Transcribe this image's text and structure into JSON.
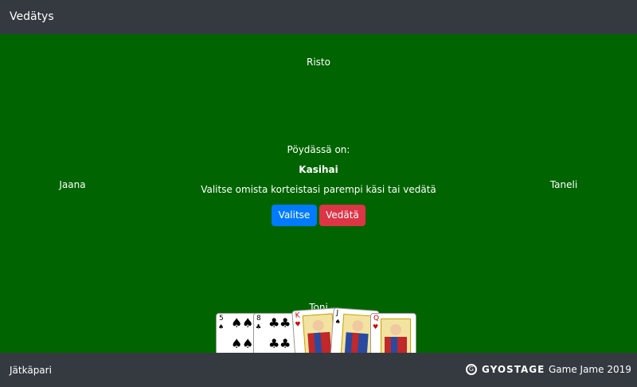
{
  "header": {
    "title": "Vedätys"
  },
  "table": {
    "players": {
      "top": "Risto",
      "left": "Jaana",
      "right": "Taneli",
      "bottom": "Toni"
    },
    "on_table_label": "Pöydässä on:",
    "current_hand": "Kasihai",
    "instruction": "Valitse omista korteistasi parempi käsi tai vedätä",
    "buttons": {
      "choose": "Valitse",
      "bluff": "Vedätä"
    },
    "hand_cards": [
      {
        "rank": "5",
        "suit": "♠",
        "color": "#000000"
      },
      {
        "rank": "8",
        "suit": "♣",
        "color": "#000000"
      },
      {
        "rank": "K",
        "suit": "♥",
        "color": "#d00000"
      },
      {
        "rank": "J",
        "suit": "♠",
        "color": "#000000"
      },
      {
        "rank": "Q",
        "suit": "♥",
        "color": "#d00000"
      }
    ]
  },
  "footer": {
    "app_name": "Jätkäpari",
    "logo_mark": "G",
    "logo_text": "GYOSTAGE",
    "credit": "Game Jame 2019"
  },
  "colors": {
    "felt": "#006400",
    "bar": "#343a40",
    "primary": "#007bff",
    "danger": "#dc3545"
  }
}
